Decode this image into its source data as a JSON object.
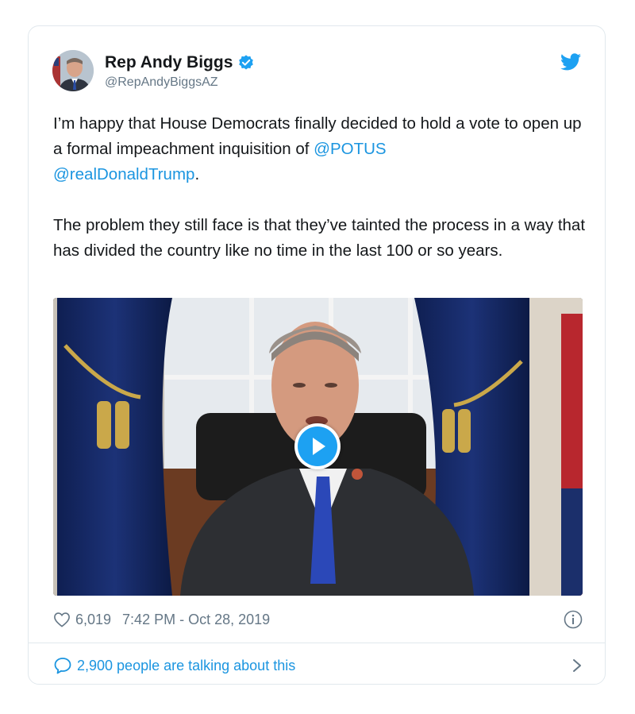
{
  "author": {
    "display_name": "Rep Andy Biggs",
    "handle": "@RepAndyBiggsAZ",
    "verified": true
  },
  "tweet": {
    "paragraph1_prefix": "I’m happy that House Democrats finally decided to hold a vote to open up a formal impeachment inquisition of ",
    "mention1": "@POTUS",
    "mention2": "@realDonaldTrump",
    "paragraph1_suffix": ".",
    "paragraph2": "The problem they still face is that they’ve tainted the process in a way that has divided the country like no time in the last 100 or so years."
  },
  "media": {
    "type": "video",
    "icon": "play-icon"
  },
  "meta": {
    "likes": "6,019",
    "timestamp": "7:42 PM - Oct 28, 2019"
  },
  "footer": {
    "talking_label": "2,900 people are talking about this"
  },
  "colors": {
    "link": "#1b95e0",
    "secondary": "#657786",
    "border": "#e1e8ed"
  }
}
